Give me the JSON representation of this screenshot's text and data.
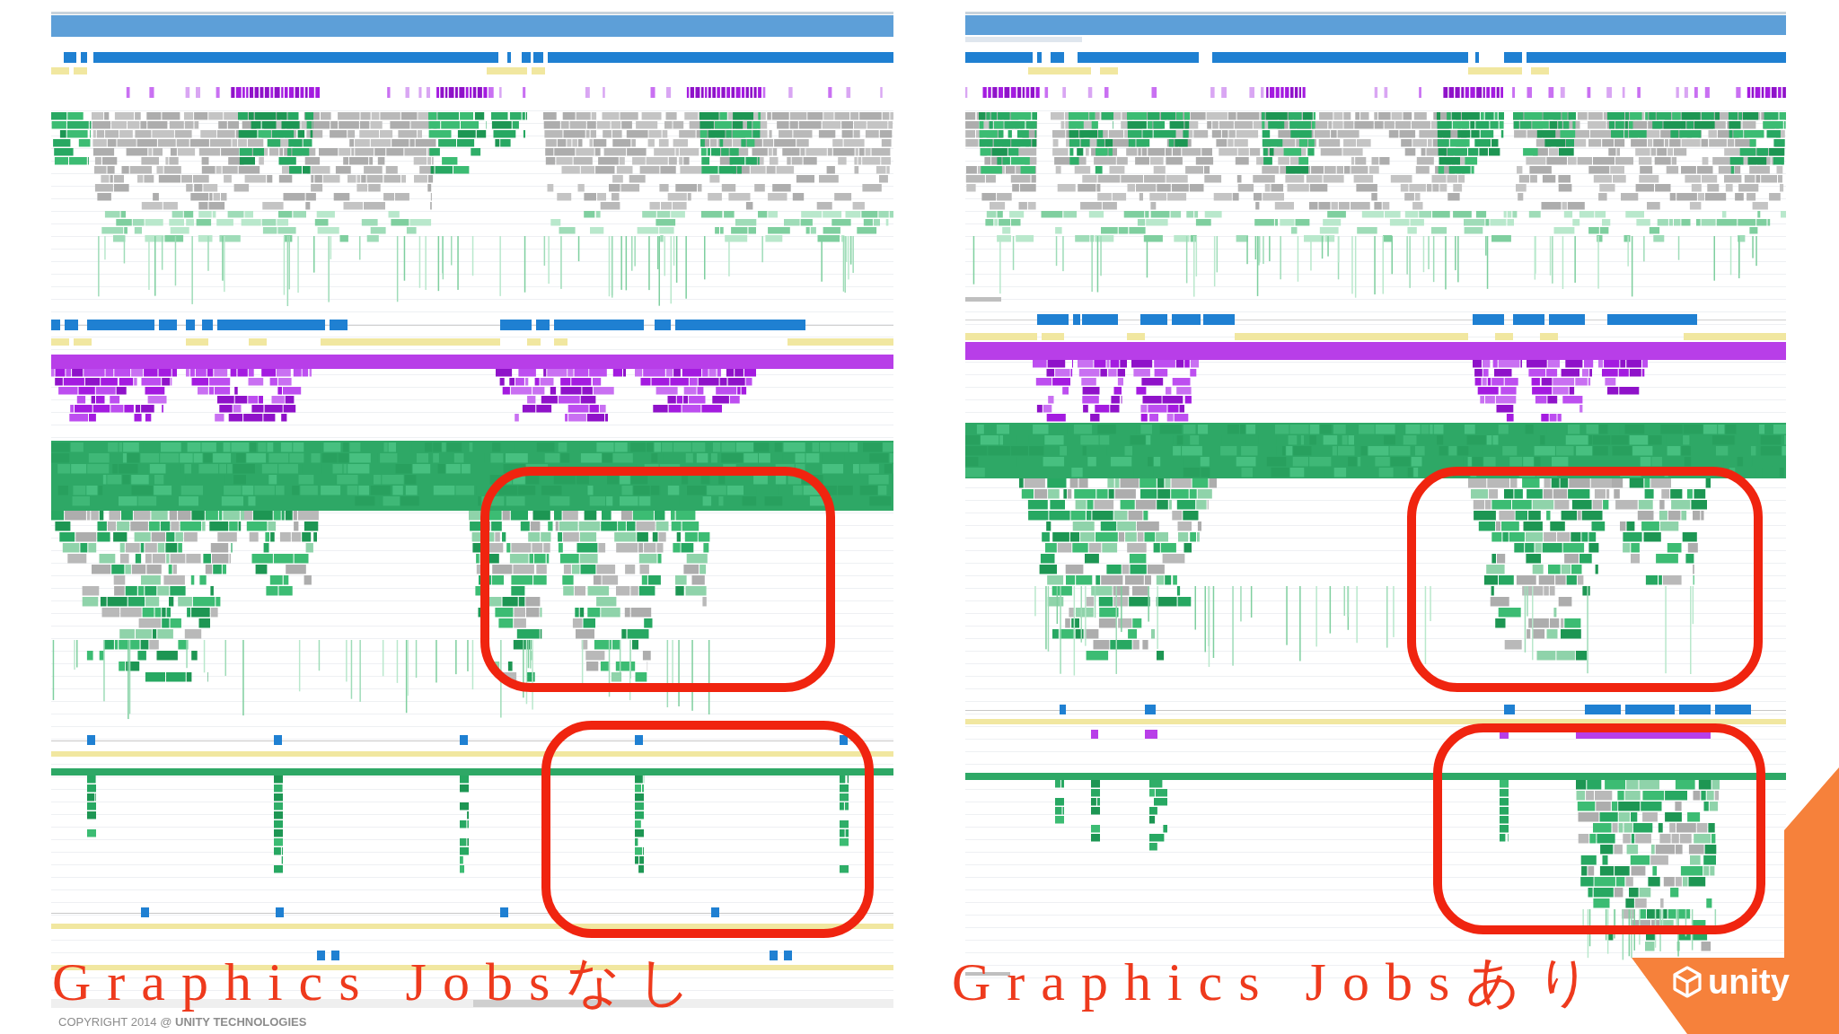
{
  "panels": [
    {
      "caption": "Graphics Jobsなし"
    },
    {
      "caption": "Graphics Jobsあり"
    }
  ],
  "footer": {
    "copyright": "COPYRIGHT 2014 @ **UNITY TECHNOLOGIES**"
  },
  "logo": {
    "text": "unity"
  }
}
